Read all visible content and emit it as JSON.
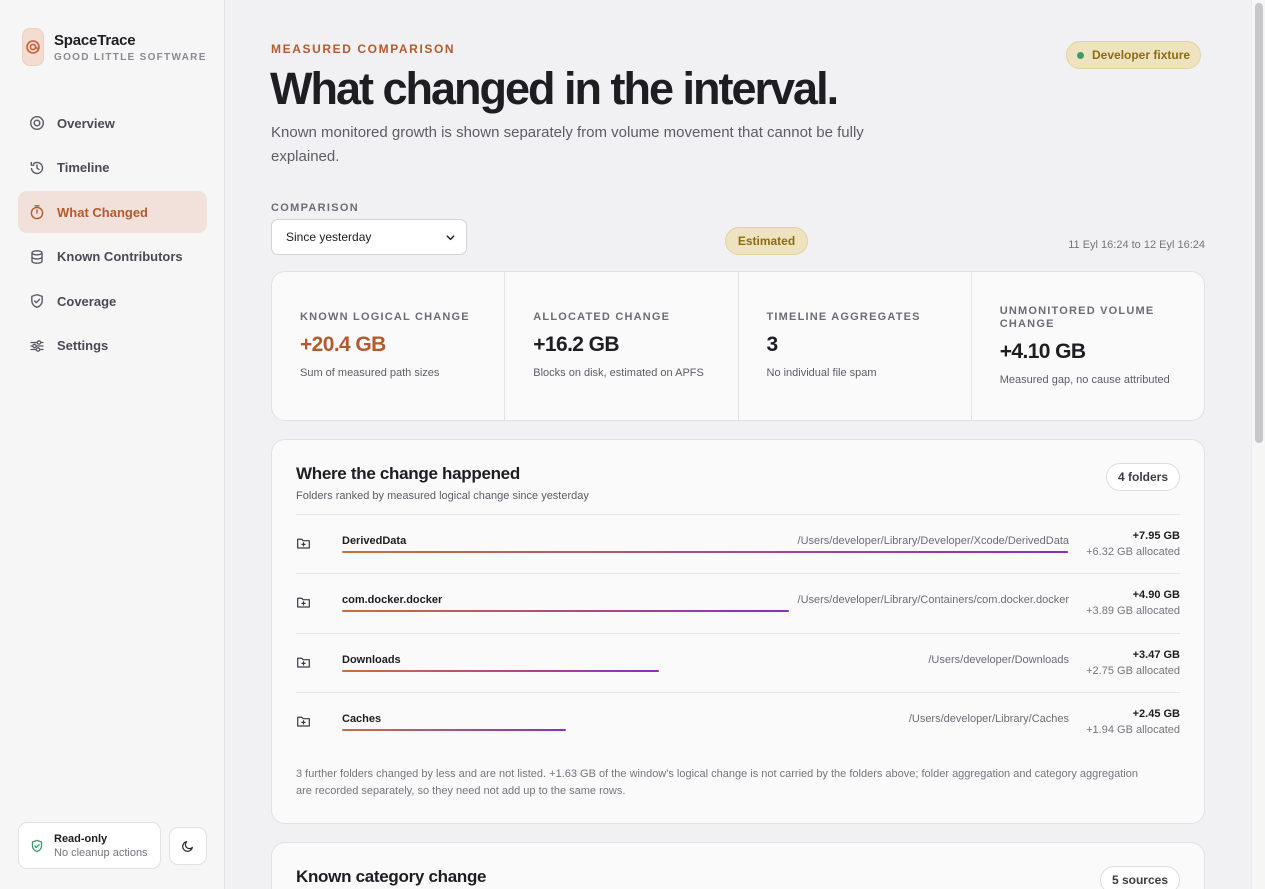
{
  "brand": {
    "name": "SpaceTrace",
    "subtitle": "GOOD LITTLE SOFTWARE"
  },
  "nav": {
    "items": [
      {
        "label": "Overview",
        "icon": "overview-icon",
        "active": false
      },
      {
        "label": "Timeline",
        "icon": "history-icon",
        "active": false
      },
      {
        "label": "What Changed",
        "icon": "stopwatch-icon",
        "active": true
      },
      {
        "label": "Known Contributors",
        "icon": "database-icon",
        "active": false
      },
      {
        "label": "Coverage",
        "icon": "shield-check-icon",
        "active": false
      },
      {
        "label": "Settings",
        "icon": "sliders-icon",
        "active": false
      }
    ]
  },
  "status": {
    "title": "Read-only",
    "subtitle": "No cleanup actions"
  },
  "header": {
    "eyebrow": "MEASURED COMPARISON",
    "title": "What changed in the interval.",
    "description": "Known monitored growth is shown separately from volume movement that cannot be fully explained.",
    "badge": "Developer fixture"
  },
  "comparison": {
    "label": "COMPARISON",
    "selected": "Since yesterday",
    "estimate_badge": "Estimated",
    "range": "11 Eyl 16:24 to 12 Eyl 16:24"
  },
  "metrics": [
    {
      "label": "KNOWN LOGICAL CHANGE",
      "value": "+20.4 GB",
      "desc": "Sum of measured path sizes"
    },
    {
      "label": "ALLOCATED CHANGE",
      "value": "+16.2 GB",
      "desc": "Blocks on disk, estimated on APFS"
    },
    {
      "label": "TIMELINE AGGREGATES",
      "value": "3",
      "desc": "No individual file spam"
    },
    {
      "label": "UNMONITORED VOLUME CHANGE",
      "value": "+4.10 GB",
      "desc": "Measured gap, no cause attributed"
    }
  ],
  "folders": {
    "title": "Where the change happened",
    "subtitle": "Folders ranked by measured logical change since yesterday",
    "count": "4 folders",
    "rows": [
      {
        "name": "DerivedData",
        "path": "/Users/developer/Library/Developer/Xcode/DerivedData",
        "value": "+7.95 GB",
        "allocated": "+6.32 GB allocated",
        "value_gb": 7.95
      },
      {
        "name": "com.docker.docker",
        "path": "/Users/developer/Library/Containers/com.docker.docker",
        "value": "+4.90 GB",
        "allocated": "+3.89 GB allocated",
        "value_gb": 4.9
      },
      {
        "name": "Downloads",
        "path": "/Users/developer/Downloads",
        "value": "+3.47 GB",
        "allocated": "+2.75 GB allocated",
        "value_gb": 3.47
      },
      {
        "name": "Caches",
        "path": "/Users/developer/Library/Caches",
        "value": "+2.45 GB",
        "allocated": "+1.94 GB allocated",
        "value_gb": 2.45
      }
    ],
    "footnote": "3 further folders changed by less and are not listed. +1.63 GB of the window's logical change is not carried by the folders above; folder aggregation and category aggregation are recorded separately, so they need not add up to the same rows."
  },
  "categories": {
    "title": "Known category change",
    "count": "5 sources"
  },
  "colors": {
    "accent": "#b35a2e",
    "bar_start": "#c9703c",
    "bar_end": "#8a2fc0",
    "estimate_bg": "#efe3bf"
  }
}
